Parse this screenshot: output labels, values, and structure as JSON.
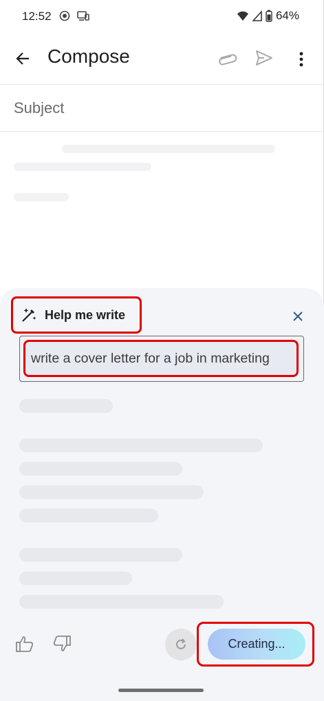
{
  "status_bar": {
    "time": "12:52",
    "battery": "64%",
    "icons": [
      "record-icon",
      "cast-icon",
      "wifi-icon",
      "signal-icon",
      "battery-icon"
    ]
  },
  "app_bar": {
    "title": "Compose",
    "icons": [
      "back-arrow-icon",
      "paperclip-icon",
      "send-icon",
      "more-vert-icon"
    ]
  },
  "compose": {
    "subject_placeholder": "Subject"
  },
  "help_me_write": {
    "label": "Help me write",
    "prompt": "write a cover letter for a job in marketing",
    "creating_label": "Creating..."
  },
  "colors": {
    "highlight": "#e00000",
    "panel_bg": "#f4f5f9",
    "creating_gradient_start": "#a8c3f5",
    "creating_gradient_end": "#a6eef6"
  }
}
